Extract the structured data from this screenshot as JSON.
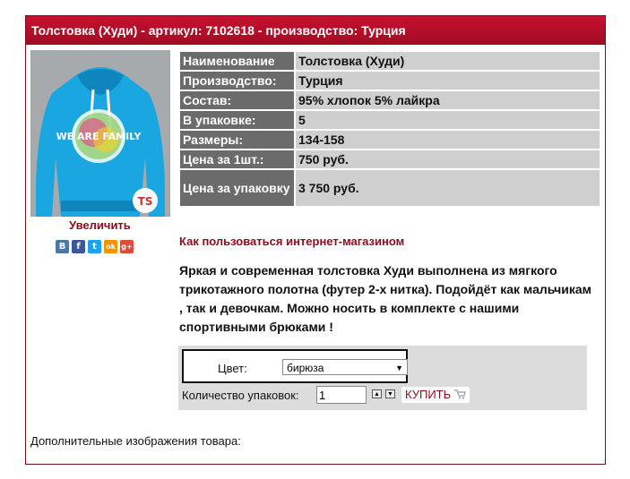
{
  "product": {
    "title": "Толстовка (Худи) - артикул: 7102618 - производство: Турция",
    "enlarge_label": "Увеличить",
    "photo_print_text": "WE ARE FAMILY",
    "brand_mark": "TS"
  },
  "social": [
    {
      "icon": "vk-icon",
      "glyph": "B",
      "color": "#4a76a8"
    },
    {
      "icon": "facebook-icon",
      "glyph": "f",
      "color": "#3b5998"
    },
    {
      "icon": "twitter-icon",
      "glyph": "t",
      "color": "#1da1f2"
    },
    {
      "icon": "odnoklassniki-icon",
      "glyph": "ok",
      "color": "#f29400"
    },
    {
      "icon": "googleplus-icon",
      "glyph": "g+",
      "color": "#dd4b39"
    }
  ],
  "specs": [
    {
      "key": "Наименование",
      "value": "Толстовка (Худи)"
    },
    {
      "key": "Производство:",
      "value": "Турция"
    },
    {
      "key": "Состав:",
      "value": "95% хлопок 5% лайкра"
    },
    {
      "key": "В упаковке:",
      "value": "5"
    },
    {
      "key": "Размеры:",
      "value": "134-158"
    },
    {
      "key": "Цена за 1шт.:",
      "value": "750 руб."
    },
    {
      "key": "Цена за упаковку",
      "value": "3 750 руб."
    }
  ],
  "howto_link": "Как пользоваться интернет-магазином",
  "description": "Яркая и современная толстовка Худи выполнена из мягкого трикотажного полотна (футер 2-х нитка). Подойдёт как мальчикам , так и девочкам. Можно носить в комплекте с нашими спортивными брюками !",
  "order": {
    "color_label": "Цвет:",
    "color_value": "бирюза",
    "qty_label": "Количество упаковок:",
    "qty_value": "1",
    "buy_label": "КУПИТЬ"
  },
  "extra_images_label": "Дополнительные изображения товара:",
  "colors": {
    "accent": "#c8102e",
    "link": "#8b0d1c",
    "key_cell": "#6b6b6b",
    "value_cell": "#cfcfcf"
  }
}
